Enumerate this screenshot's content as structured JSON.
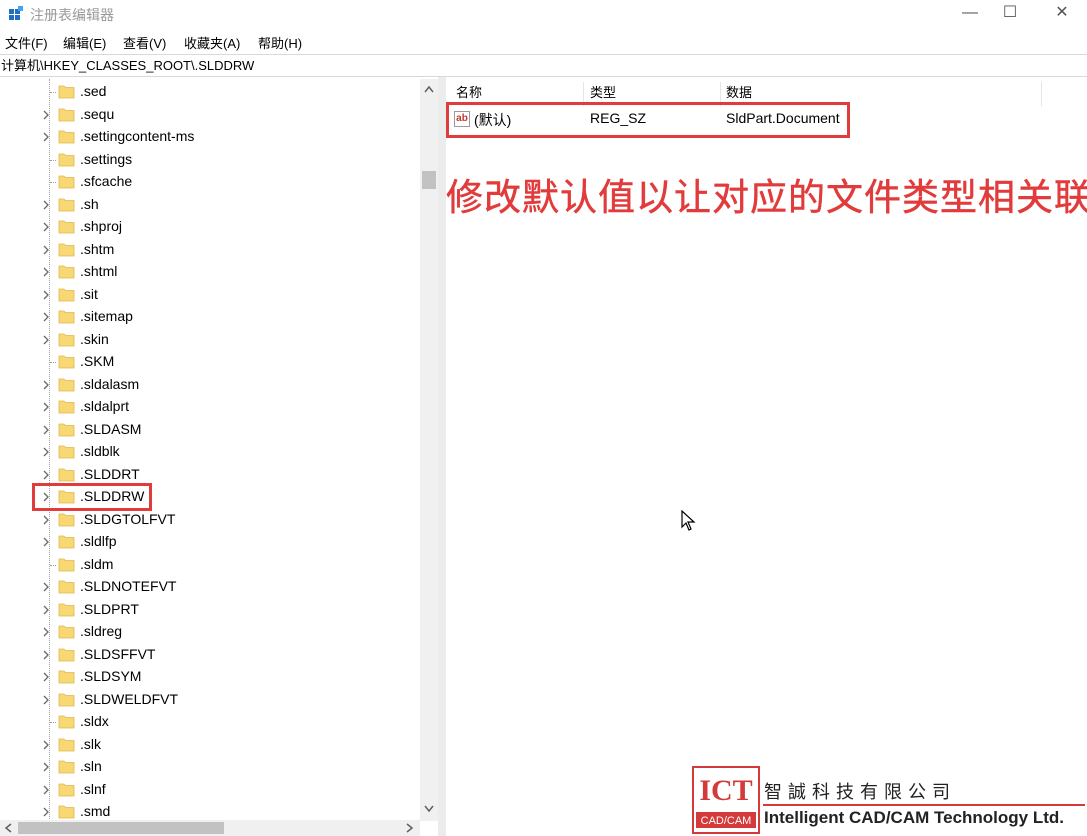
{
  "window": {
    "title": "注册表编辑器",
    "minimize": "—",
    "maximize": "☐",
    "close": "✕"
  },
  "menu": [
    "文件(F)",
    "编辑(E)",
    "查看(V)",
    "收藏夹(A)",
    "帮助(H)"
  ],
  "address": "计算机\\HKEY_CLASSES_ROOT\\.SLDDRW",
  "tree": {
    "items": [
      {
        "label": ".sed",
        "expandable": false
      },
      {
        "label": ".sequ",
        "expandable": true
      },
      {
        "label": ".settingcontent-ms",
        "expandable": true
      },
      {
        "label": ".settings",
        "expandable": false
      },
      {
        "label": ".sfcache",
        "expandable": false
      },
      {
        "label": ".sh",
        "expandable": true
      },
      {
        "label": ".shproj",
        "expandable": true
      },
      {
        "label": ".shtm",
        "expandable": true
      },
      {
        "label": ".shtml",
        "expandable": true
      },
      {
        "label": ".sit",
        "expandable": true
      },
      {
        "label": ".sitemap",
        "expandable": true
      },
      {
        "label": ".skin",
        "expandable": true
      },
      {
        "label": ".SKM",
        "expandable": false
      },
      {
        "label": ".sldalasm",
        "expandable": true
      },
      {
        "label": ".sldalprt",
        "expandable": true
      },
      {
        "label": ".SLDASM",
        "expandable": true
      },
      {
        "label": ".sldblk",
        "expandable": true
      },
      {
        "label": ".SLDDRT",
        "expandable": true
      },
      {
        "label": ".SLDDRW",
        "expandable": true,
        "selected": true
      },
      {
        "label": ".SLDGTOLFVT",
        "expandable": true
      },
      {
        "label": ".sldlfp",
        "expandable": true
      },
      {
        "label": ".sldm",
        "expandable": false
      },
      {
        "label": ".SLDNOTEFVT",
        "expandable": true
      },
      {
        "label": ".SLDPRT",
        "expandable": true
      },
      {
        "label": ".sldreg",
        "expandable": true
      },
      {
        "label": ".SLDSFFVT",
        "expandable": true
      },
      {
        "label": ".SLDSYM",
        "expandable": true
      },
      {
        "label": ".SLDWELDFVT",
        "expandable": true
      },
      {
        "label": ".sldx",
        "expandable": false
      },
      {
        "label": ".slk",
        "expandable": true
      },
      {
        "label": ".sln",
        "expandable": true
      },
      {
        "label": ".slnf",
        "expandable": true
      },
      {
        "label": ".smd",
        "expandable": true
      }
    ]
  },
  "values_pane": {
    "columns": {
      "name": "名称",
      "type": "类型",
      "data": "数据"
    },
    "rows": [
      {
        "icon": "string-value-icon",
        "icon_text": "ab",
        "name": "(默认)",
        "type": "REG_SZ",
        "data": "SldPart.Document"
      }
    ]
  },
  "annotation": "修改默认值以让对应的文件类型相关联",
  "colors": {
    "highlight": "#e23b3b",
    "folder": "#f8d775",
    "folder_edge": "#e0b84a"
  },
  "watermark": {
    "logo_main": "ICT",
    "logo_sub": "CAD/CAM",
    "company_cn": "智誠科技有限公司",
    "company_en": "Intelligent CAD/CAM Technology Ltd."
  }
}
